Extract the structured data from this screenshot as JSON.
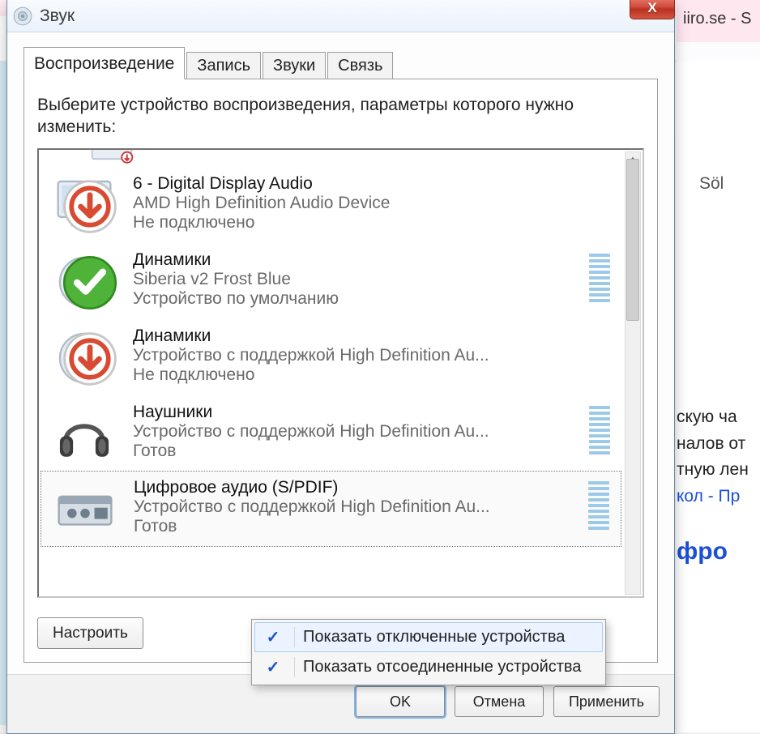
{
  "background": {
    "title_fragment": "iiro.se - S",
    "search_label": "Söl",
    "body_lines": [
      "скую ча",
      "налов от",
      "тную лен"
    ],
    "link_fragment": "кол - Пр",
    "heading_fragment": "фро"
  },
  "dialog": {
    "title": "Звук",
    "close_symbol": "X",
    "tabs": [
      {
        "label": "Воспроизведение",
        "active": true
      },
      {
        "label": "Запись",
        "active": false
      },
      {
        "label": "Звуки",
        "active": false
      },
      {
        "label": "Связь",
        "active": false
      }
    ],
    "instruction": "Выберите устройство воспроизведения, параметры которого нужно изменить:",
    "devices": [
      {
        "name": "6 - Digital Display Audio",
        "desc": "AMD High Definition Audio Device",
        "status": "Не подключено",
        "icon": "monitor",
        "badge": "down-arrow",
        "meter": false,
        "selected": false
      },
      {
        "name": "Динамики",
        "desc": "Siberia v2 Frost Blue",
        "status": "Устройство по умолчанию",
        "icon": "speaker",
        "badge": "check",
        "meter": true,
        "selected": false
      },
      {
        "name": "Динамики",
        "desc": "Устройство с поддержкой High Definition Au...",
        "status": "Не подключено",
        "icon": "speaker",
        "badge": "down-arrow",
        "meter": false,
        "selected": false
      },
      {
        "name": "Наушники",
        "desc": "Устройство с поддержкой High Definition Au...",
        "status": "Готов",
        "icon": "headphones",
        "badge": null,
        "meter": true,
        "selected": false
      },
      {
        "name": "Цифровое аудио (S/PDIF)",
        "desc": "Устройство с поддержкой High Definition Au...",
        "status": "Готов",
        "icon": "spdif",
        "badge": null,
        "meter": true,
        "selected": true
      }
    ],
    "configure_label": "Настроить",
    "footer": {
      "ok": "OK",
      "cancel": "Отмена",
      "apply": "Применить"
    }
  },
  "context_menu": {
    "items": [
      {
        "label": "Показать отключенные устройства",
        "checked": true,
        "hl": true
      },
      {
        "label": "Показать отсоединенные устройства",
        "checked": true,
        "hl": false
      }
    ]
  }
}
